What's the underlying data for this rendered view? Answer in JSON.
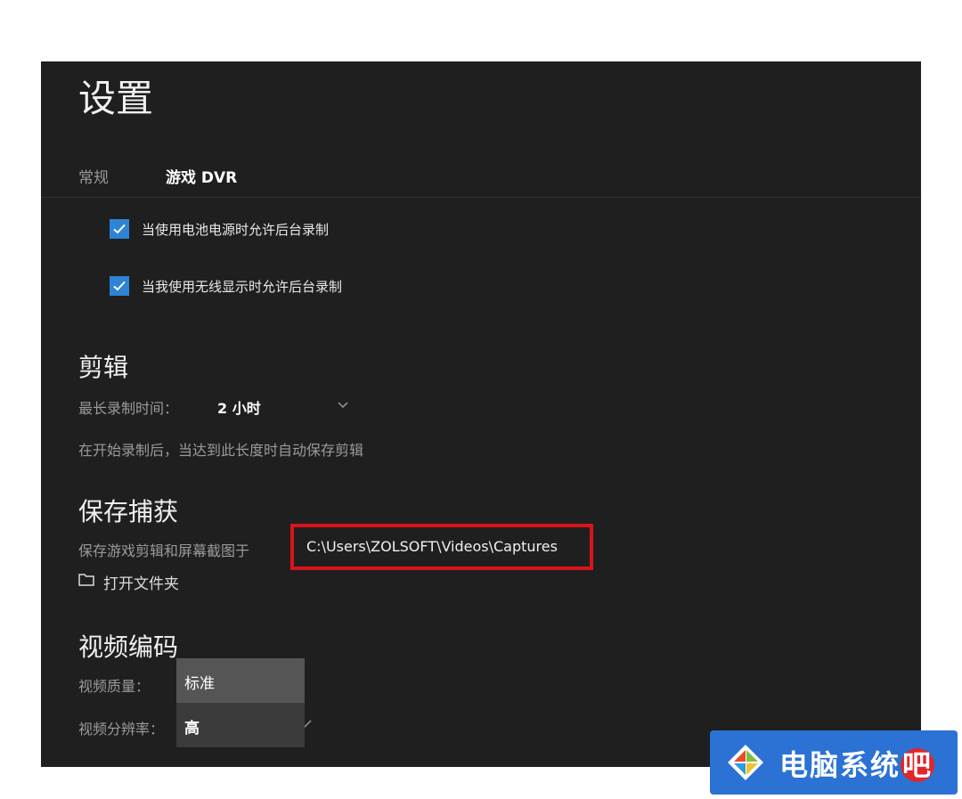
{
  "page": {
    "title": "设置"
  },
  "tabs": [
    {
      "label": "常规",
      "selected": false
    },
    {
      "label": "游戏 DVR",
      "selected": true
    }
  ],
  "background_recording": {
    "options": [
      {
        "label": "当使用电池电源时允许后台录制",
        "checked": true
      },
      {
        "label": "当我使用无线显示时允许后台录制",
        "checked": true
      }
    ]
  },
  "clips": {
    "heading": "剪辑",
    "max_length_label": "最长录制时间：",
    "max_length_value": "2 小时",
    "description": "在开始录制后，当达到此长度时自动保存剪辑"
  },
  "save_captures": {
    "heading": "保存捕获",
    "label": "保存游戏剪辑和屏幕截图于",
    "path": "C:\\Users\\ZOLSOFT\\Videos\\Captures",
    "open_folder_label": "打开文件夹"
  },
  "video_encoding": {
    "heading": "视频编码",
    "quality_label": "视频质量：",
    "resolution_label": "视频分辨率：",
    "dropdown_options": [
      "标准",
      "高"
    ]
  },
  "watermark": {
    "text": "电脑系统",
    "last_char": "吧"
  },
  "colors": {
    "panel_bg": "#1f1f1f",
    "accent": "#2e84d4",
    "highlight_border": "#d8141b",
    "watermark_bg": "#2b72d4"
  }
}
